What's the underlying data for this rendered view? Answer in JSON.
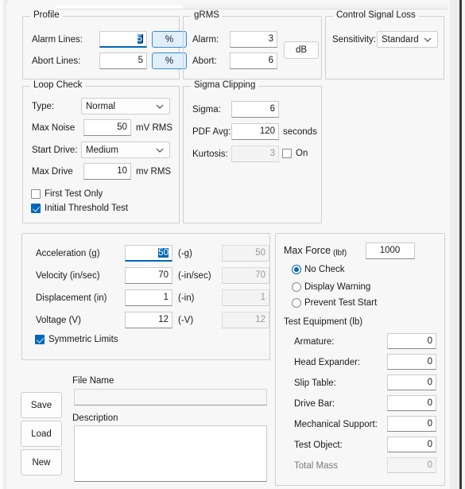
{
  "window": {
    "accent_color": "#0067b8",
    "bg_color": "#f7f7f7"
  },
  "profile": {
    "title": "Profile",
    "alarm_lines_label": "Alarm Lines:",
    "alarm_lines_value": "5",
    "alarm_unit_button": "%",
    "abort_lines_label": "Abort Lines:",
    "abort_lines_value": "5",
    "abort_unit_button": "%"
  },
  "grms": {
    "title": "gRMS",
    "alarm_label": "Alarm:",
    "alarm_value": "3",
    "abort_label": "Abort:",
    "abort_value": "6",
    "unit_button": "dB"
  },
  "control_signal_loss": {
    "title": "Control Signal Loss",
    "sensitivity_label": "Sensitivity:",
    "sensitivity_value": "Standard"
  },
  "loop_check": {
    "title": "Loop Check",
    "type_label": "Type:",
    "type_value": "Normal",
    "max_noise_label": "Max Noise",
    "max_noise_value": "50",
    "max_noise_unit": "mV RMS",
    "start_drive_label": "Start Drive:",
    "start_drive_value": "Medium",
    "max_drive_label": "Max Drive",
    "max_drive_value": "10",
    "max_drive_unit": "mv RMS",
    "first_test_only_label": "First Test Only",
    "first_test_only_checked": false,
    "initial_threshold_label": "Initial Threshold Test",
    "initial_threshold_checked": true
  },
  "sigma_clipping": {
    "title": "Sigma Clipping",
    "sigma_label": "Sigma:",
    "sigma_value": "6",
    "pdf_avg_label": "PDF Avg:",
    "pdf_avg_value": "120",
    "pdf_avg_unit": "seconds",
    "kurtosis_label": "Kurtosis:",
    "kurtosis_value": "3",
    "kurtosis_on_label": "On",
    "kurtosis_on_checked": false
  },
  "limits": {
    "rows": [
      {
        "label": "Acceleration (g)",
        "value": "50",
        "neg_label": "(-g)",
        "neg_value": "50",
        "focused": true
      },
      {
        "label": "Velocity (in/sec)",
        "value": "70",
        "neg_label": "(-in/sec)",
        "neg_value": "70",
        "focused": false
      },
      {
        "label": "Displacement (in)",
        "value": "1",
        "neg_label": "(-in)",
        "neg_value": "1",
        "focused": false
      },
      {
        "label": "Voltage (V)",
        "value": "12",
        "neg_label": "(-V)",
        "neg_value": "12",
        "focused": false
      }
    ],
    "symmetric_limits_label": "Symmetric Limits",
    "symmetric_limits_checked": true
  },
  "max_force": {
    "label": "Max Force",
    "unit": "(lbf)",
    "value": "1000",
    "options": [
      {
        "label": "No Check",
        "selected": true
      },
      {
        "label": "Display Warning",
        "selected": false
      },
      {
        "label": "Prevent Test Start",
        "selected": false
      }
    ]
  },
  "test_equipment": {
    "title": "Test Equipment (lb)",
    "rows": [
      {
        "label": "Armature:",
        "value": "0",
        "disabled": false
      },
      {
        "label": "Head Expander:",
        "value": "0",
        "disabled": false
      },
      {
        "label": "Slip Table:",
        "value": "0",
        "disabled": false
      },
      {
        "label": "Drive Bar:",
        "value": "0",
        "disabled": false
      },
      {
        "label": "Mechanical Support:",
        "value": "0",
        "disabled": false
      },
      {
        "label": "Test Object:",
        "value": "0",
        "disabled": false
      },
      {
        "label": "Total Mass",
        "value": "0",
        "disabled": true
      }
    ]
  },
  "file_section": {
    "save_button": "Save",
    "load_button": "Load",
    "new_button": "New",
    "file_name_label": "File Name",
    "file_name_value": "",
    "description_label": "Description",
    "description_value": ""
  }
}
